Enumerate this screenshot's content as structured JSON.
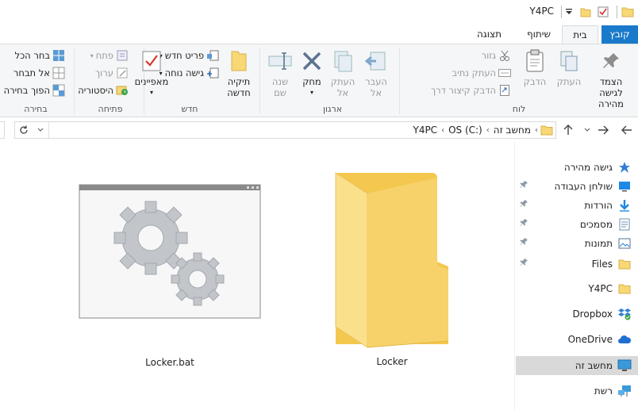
{
  "window": {
    "title": "Y4PC"
  },
  "tabs": {
    "file": "קובץ",
    "home": "בית",
    "share": "שיתוף",
    "view": "תצוגה"
  },
  "ribbon": {
    "clipboard": {
      "label": "לוח",
      "pin": "הצמד לגישה\nמהירה",
      "copy": "העתק",
      "paste": "הדבק",
      "cut": "גזור",
      "copy_path": "העתק נתיב",
      "paste_shortcut": "הדבק קיצור דרך"
    },
    "organize": {
      "label": "ארגון",
      "move_to": "העבר\nאל",
      "copy_to": "העתק\nאל",
      "delete": "מחק",
      "rename": "שנה\nשם"
    },
    "new": {
      "label": "חדש",
      "new_folder": "תיקיה\nחדשה",
      "new_item": "פריט חדש",
      "easy_access": "גישה נוחה"
    },
    "open": {
      "label": "פתיחה",
      "properties": "מאפיינים",
      "open": "פתח",
      "edit": "ערוך",
      "history": "היסטוריה"
    },
    "select": {
      "label": "בחירה",
      "select_all": "בחר הכל",
      "select_none": "אל תבחר",
      "invert": "הפוך בחירה"
    }
  },
  "address": {
    "crumbs": [
      "מחשב זה",
      "OS (C:)",
      "Y4PC"
    ]
  },
  "nav": {
    "items": [
      {
        "label": "גישה מהירה",
        "icon": "star-icon"
      },
      {
        "label": "שולחן העבודה",
        "icon": "desktop-icon",
        "pinned": true
      },
      {
        "label": "הורדות",
        "icon": "download-icon",
        "pinned": true
      },
      {
        "label": "מסמכים",
        "icon": "documents-icon",
        "pinned": true
      },
      {
        "label": "תמונות",
        "icon": "pictures-icon",
        "pinned": true
      },
      {
        "label": "Files",
        "icon": "folder-icon",
        "pinned": true
      },
      {
        "label": "Y4PC",
        "icon": "folder-icon"
      },
      {
        "label": "Dropbox",
        "icon": "dropbox-icon"
      },
      {
        "label": "OneDrive",
        "icon": "onedrive-icon"
      },
      {
        "label": "מחשב זה",
        "icon": "computer-icon",
        "selected": true
      },
      {
        "label": "רשת",
        "icon": "network-icon"
      }
    ]
  },
  "files": [
    {
      "name": "Locker",
      "type": "folder"
    },
    {
      "name": "Locker.bat",
      "type": "batch"
    }
  ],
  "colors": {
    "accent": "#1979ca",
    "folder": "#f8d775",
    "selection": "#d9d9d9"
  }
}
